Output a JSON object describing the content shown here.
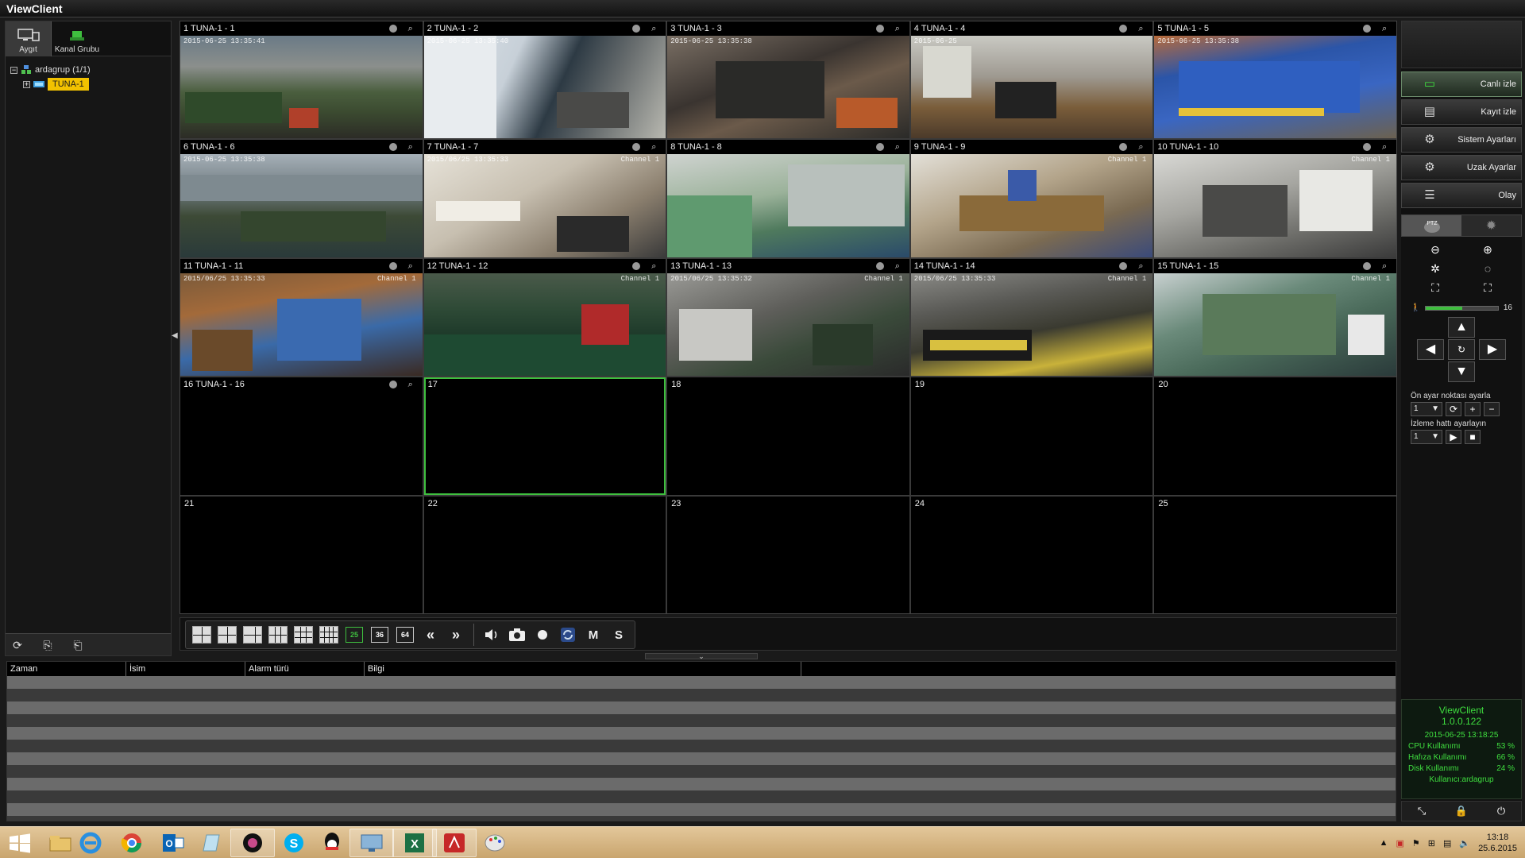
{
  "app": {
    "title": "ViewClient"
  },
  "left_panel": {
    "tabs": [
      {
        "label": "Aygıt"
      },
      {
        "label": "Kanal Grubu"
      }
    ],
    "tree": {
      "group": "ardagrup (1/1)",
      "device": "TUNA-1"
    }
  },
  "cameras": [
    {
      "label": "1 TUNA-1 - 1",
      "osd": "2015-06-25 13:35:41"
    },
    {
      "label": "2 TUNA-1 - 2",
      "osd": "2015-06-25 13:35:40"
    },
    {
      "label": "3 TUNA-1 - 3",
      "osd": "2015-06-25 13:35:38"
    },
    {
      "label": "4 TUNA-1 - 4",
      "osd": "2015-06-25"
    },
    {
      "label": "5 TUNA-1 - 5",
      "osd": "2015-06-25 13:35:38"
    },
    {
      "label": "6 TUNA-1 - 6",
      "osd": "2015-06-25 13:35:38"
    },
    {
      "label": "7 TUNA-1 - 7",
      "osd": "2015/06/25 13:35:33",
      "channel": "Channel 1"
    },
    {
      "label": "8 TUNA-1 - 8",
      "osd": ""
    },
    {
      "label": "9 TUNA-1 - 9",
      "osd": "",
      "channel": "Channel 1"
    },
    {
      "label": "10 TUNA-1 - 10",
      "osd": "",
      "channel": "Channel 1"
    },
    {
      "label": "11 TUNA-1 - 11",
      "osd": "2015/06/25 13:35:33",
      "channel": "Channel 1"
    },
    {
      "label": "12 TUNA-1 - 12",
      "osd": "",
      "channel": "Channel 1"
    },
    {
      "label": "13 TUNA-1 - 13",
      "osd": "2015/06/25 13:35:32",
      "channel": "Channel 1"
    },
    {
      "label": "14 TUNA-1 - 14",
      "osd": "2015/06/25 13:35:33",
      "channel": "Channel 1"
    },
    {
      "label": "15 TUNA-1 - 15",
      "osd": "",
      "channel": "Channel 1"
    },
    {
      "label": "16 TUNA-1 - 16"
    }
  ],
  "empty_cells": [
    "17",
    "18",
    "19",
    "20",
    "21",
    "22",
    "23",
    "24",
    "25"
  ],
  "selected_cell": "17",
  "toolbar": {
    "layout_numbers": [
      "25",
      "36",
      "64"
    ],
    "active_layout": "25",
    "m_label": "M",
    "s_label": "S"
  },
  "log": {
    "columns": [
      "Zaman",
      "İsim",
      "Alarm türü",
      "Bilgi"
    ]
  },
  "right_panel": {
    "nav": [
      {
        "label": "Canlı izle",
        "icon": "monitor-icon",
        "active": true
      },
      {
        "label": "Kayıt izle",
        "icon": "playback-icon",
        "active": false
      },
      {
        "label": "Sistem Ayarları",
        "icon": "gear-icon",
        "active": false
      },
      {
        "label": "Uzak Ayarlar",
        "icon": "remote-gear-icon",
        "active": false
      },
      {
        "label": "Olay",
        "icon": "list-icon",
        "active": false
      }
    ],
    "ptz": {
      "tab_ptz": "PTZ",
      "speed": "16",
      "speed_fraction": 0.5,
      "preset_label": "Ön ayar noktası ayarla",
      "preset_value": "1",
      "track_label": "İzleme hattı ayarlayın",
      "track_value": "1"
    },
    "status": {
      "title": "ViewClient",
      "version": "1.0.0.122",
      "datetime": "2015-06-25 13:18:25",
      "cpu_label": "CPU Kullanımı",
      "cpu_value": "53 %",
      "mem_label": "Hafıza Kullanımı",
      "mem_value": "66 %",
      "disk_label": "Disk Kullanımı",
      "disk_value": "24 %",
      "user": "Kullanıcı:ardagrup"
    }
  },
  "taskbar": {
    "time": "13:18",
    "date": "25.6.2015"
  }
}
